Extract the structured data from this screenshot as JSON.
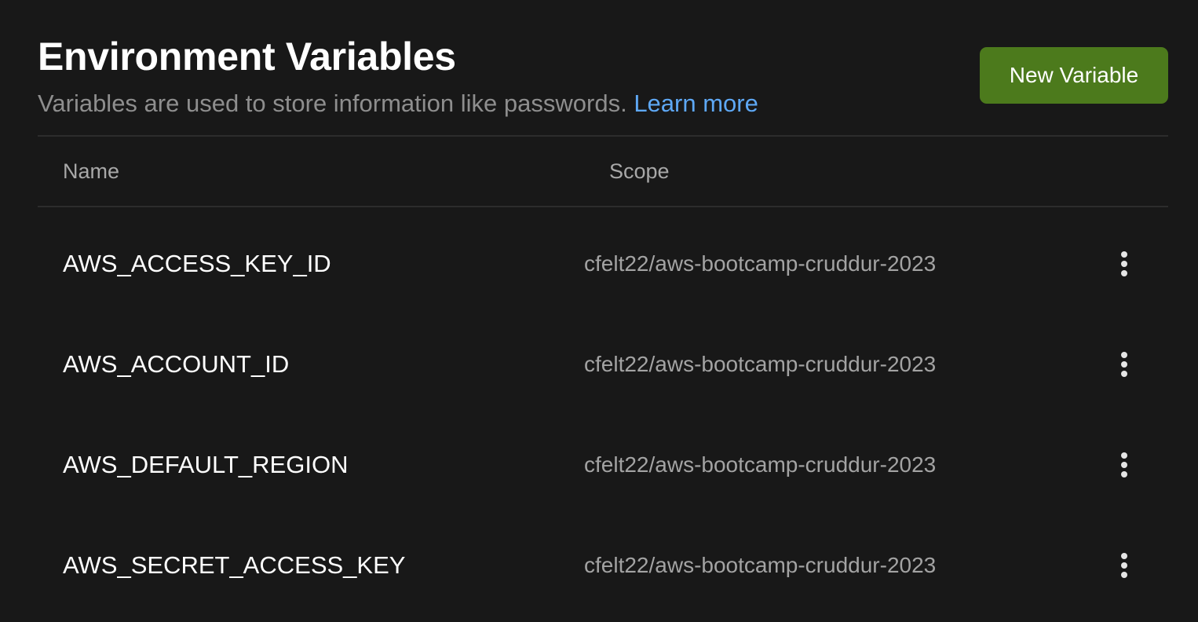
{
  "header": {
    "title": "Environment Variables",
    "subtitle": "Variables are used to store information like passwords.",
    "learn_more": "Learn more",
    "new_button": "New Variable"
  },
  "table": {
    "columns": [
      "Name",
      "Scope"
    ],
    "rows": [
      {
        "name": "AWS_ACCESS_KEY_ID",
        "scope": "cfelt22/aws-bootcamp-cruddur-2023"
      },
      {
        "name": "AWS_ACCOUNT_ID",
        "scope": "cfelt22/aws-bootcamp-cruddur-2023"
      },
      {
        "name": "AWS_DEFAULT_REGION",
        "scope": "cfelt22/aws-bootcamp-cruddur-2023"
      },
      {
        "name": "AWS_SECRET_ACCESS_KEY",
        "scope": "cfelt22/aws-bootcamp-cruddur-2023"
      }
    ],
    "row_action_icon": "more-vertical-icon"
  },
  "colors": {
    "background": "#181818",
    "accent_button": "#4c7a1c",
    "link": "#5ea8f5",
    "divider": "#2c2c2c"
  }
}
